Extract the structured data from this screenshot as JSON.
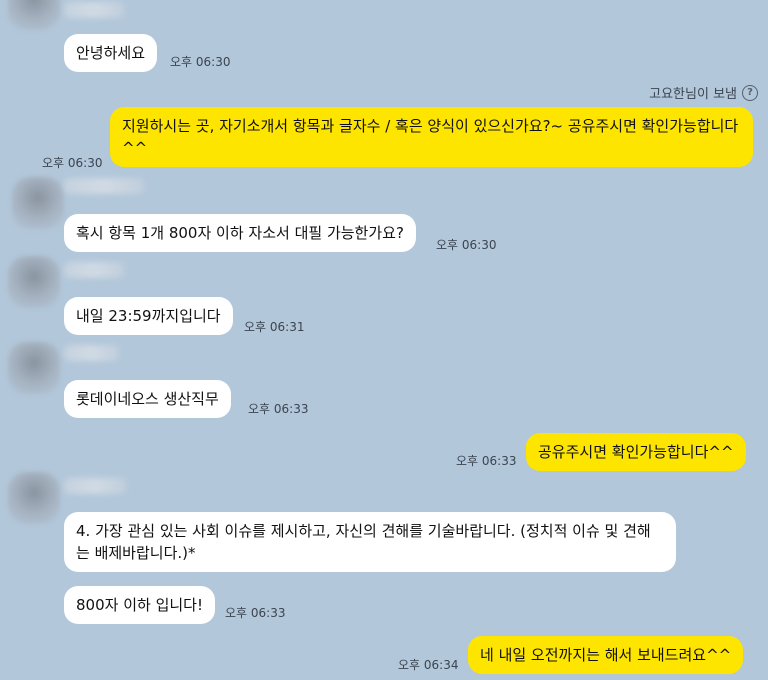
{
  "messages": {
    "m1": {
      "text": "안녕하세요",
      "time": "오후 06:30"
    },
    "m2": {
      "status": "고요한님이 보냄",
      "text": "지원하시는 곳, 자기소개서 항목과 글자수 / 혹은 양식이 있으신가요?~ 공유주시면 확인가능합니다^^",
      "time": "오후 06:30"
    },
    "m3": {
      "text": "혹시 항목 1개 800자 이하 자소서 대필 가능한가요?",
      "time": "오후 06:30"
    },
    "m4": {
      "text": "내일 23:59까지입니다",
      "time": "오후 06:31"
    },
    "m5": {
      "text": "롯데이네오스 생산직무",
      "time": "오후 06:33"
    },
    "m6": {
      "text": "공유주시면 확인가능합니다^^",
      "time": "오후 06:33"
    },
    "m7": {
      "text": "4. 가장 관심 있는 사회 이슈를 제시하고, 자신의 견해를 기술바랍니다. (정치적 이슈 및 견해는 배제바랍니다.)*"
    },
    "m8": {
      "text": "800자 이하 입니다!",
      "time": "오후 06:33"
    },
    "m9": {
      "text": "네 내일 오전까지는 해서 보내드려요^^",
      "time": "오후 06:34"
    }
  },
  "colors": {
    "background": "#b2c7da",
    "incoming": "#ffffff",
    "outgoing": "#fee500"
  },
  "icons": {
    "status_help": "question-circle-icon"
  }
}
